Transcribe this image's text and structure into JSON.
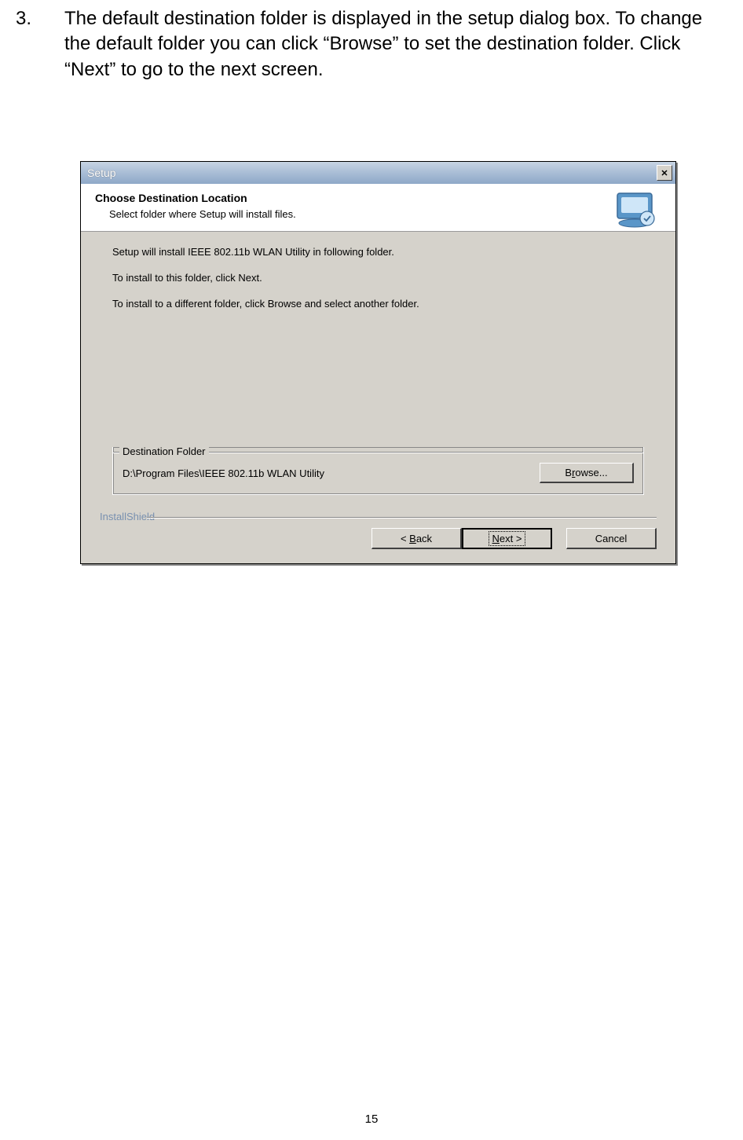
{
  "page": {
    "step_number": "3.",
    "step_text": "The default destination folder is displayed in the setup dialog box. To change the default folder you can click “Browse” to set the destination folder. Click “Next” to go to the next screen.",
    "page_number": "15"
  },
  "dialog": {
    "title": "Setup",
    "close_glyph": "✕",
    "header_title": "Choose Destination Location",
    "header_subtitle": "Select folder where Setup will install files.",
    "body_line_1": "Setup will install IEEE 802.11b WLAN Utility in following folder.",
    "body_line_2": "To install to this folder, click Next.",
    "body_line_3": "To install to a different folder, click Browse and select another folder.",
    "fieldset_legend": "Destination Folder",
    "destination_path": "D:\\Program Files\\IEEE 802.11b WLAN Utility",
    "browse_label": "Browse...",
    "install_shield": "InstallShield",
    "back_label": "< Back",
    "next_label": "Next >",
    "cancel_label": "Cancel"
  }
}
